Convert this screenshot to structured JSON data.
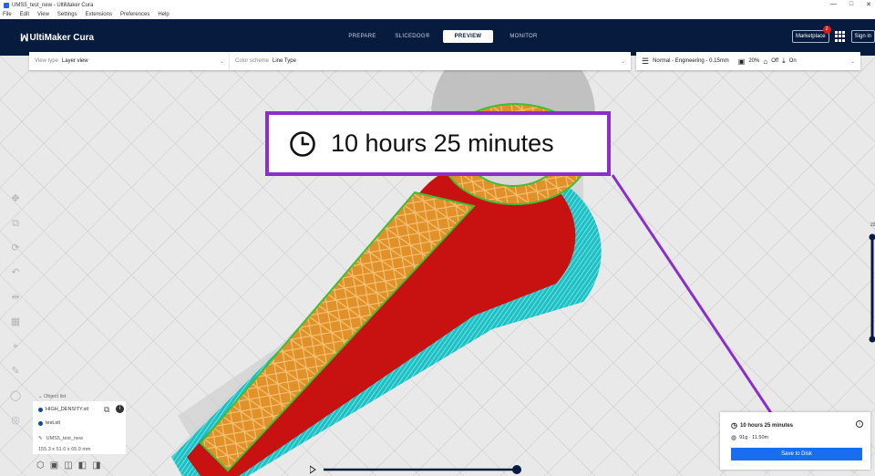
{
  "window": {
    "title": "UMS5_test_new - UltiMaker Cura",
    "controls": [
      "—",
      "□",
      "✕"
    ]
  },
  "menu": [
    "File",
    "Edit",
    "View",
    "Settings",
    "Extensions",
    "Preferences",
    "Help"
  ],
  "header": {
    "brand": "UltiMaker Cura",
    "stages": [
      "PREPARE",
      "SLICEDOG®",
      "PREVIEW",
      "MONITOR"
    ],
    "active_stage": "PREVIEW",
    "marketplace": "Marketplace",
    "marketplace_badge": "2",
    "signin": "Sign in"
  },
  "toolbar": {
    "view_type_label": "View type",
    "view_type_value": "Layer view",
    "color_scheme_label": "Color scheme",
    "color_scheme_value": "Line Type",
    "profile": "Normal - Engineering - 0.15mm",
    "infill": "20%",
    "support": "Off",
    "adhesion": "On"
  },
  "callout": {
    "time": "10 hours 25 minutes"
  },
  "object_list": {
    "header": "Object list",
    "items": [
      "HIGH_DENSITY.stl",
      "test.stl"
    ],
    "project": "UMS5_test_new",
    "dimensions": "155.3 x 51.0 x 65.9 mm"
  },
  "output": {
    "time": "10 hours 25 minutes",
    "material": "91g · 11.50m",
    "save_button": "Save to Disk"
  },
  "layer_slider": {
    "label": "22"
  },
  "colors": {
    "header_bg": "#061b3d",
    "callout_border": "#8a2fc7",
    "save_button": "#196ef0",
    "model_red": "#cc1010",
    "infill_orange": "#f0a030",
    "skirt_cyan": "#30d8d8"
  }
}
